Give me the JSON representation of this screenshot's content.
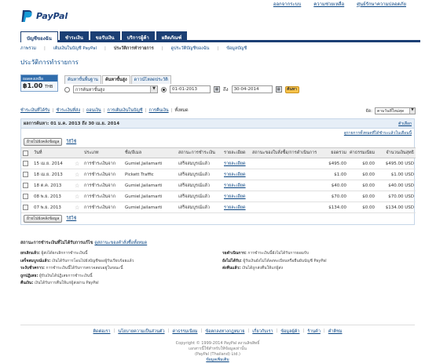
{
  "header": {
    "logo_text": "PayPal",
    "top_links": [
      "ออกจากระบบ",
      "ความช่วยเหลือ",
      "ศูนย์รักษาความปลอดภัย"
    ]
  },
  "tabs": [
    "บัญชีของฉัน",
    "ชำระเงิน",
    "ขอรับเงิน",
    "บริการผู้ค้า",
    "ผลิตภัณฑ์"
  ],
  "subnav": [
    "ภาพรวม",
    "เติมเงินในบัญชี PayPal",
    "ประวัติการทำรายการ",
    "ดูประวัติบัญชีของฉัน",
    "ข้อมูลบัญชี"
  ],
  "page_title": "ประวัติการทำรายการ",
  "balance": {
    "header": "ยอดคงเหลือ",
    "amount": "฿1.00",
    "currency": "THB"
  },
  "view_tabs": [
    "ค้นหาขั้นพื้นฐาน",
    "ค้นหาขั้นสูง",
    "ดาวน์โหลดประวัติ"
  ],
  "filter": {
    "select_value": "การค้นหาขั้นสูง",
    "date_from": "01-01-2013",
    "date_to": "30-04-2014",
    "go_label": "ค้นหา",
    "to_label": "ถึง"
  },
  "quick_filters": [
    "ชำระเงินที่ได้รับ",
    "ชำระเงินที่ส่ง",
    "ถอนเงิน",
    "การเติมเงินในบัญชี",
    "การคืนเงิน",
    "ทั้งหมด"
  ],
  "sort": {
    "label": "จัด:",
    "value": "ตามวันที่ใหม่สุด"
  },
  "panel": {
    "range_text": "ผลการค้นหา: 01 ม.ค. 2013 ถึง 30 เม.ย. 2014",
    "right_link": "ตัวเลือก",
    "notice": "ดูรายการทั้งหมดที่ได้ชำระแล้วในเดือนนี้",
    "archive_btn": "ย้ายไปยังคลังข้อมูล",
    "help_link": "วิธีใช้",
    "columns": [
      "",
      "วันที่",
      "",
      "ประเภท",
      "ชื่อ/อีเมล",
      "สถานะการชำระเงิน",
      "รายละเอียด",
      "สถานะของใบสั่งซื้อ/การดำเนินการ",
      "ยอดรวม",
      "ค่าธรรมเนียม",
      "จำนวนเงินสุทธิ"
    ],
    "rows": [
      {
        "date": "15 เม.ย. 2014",
        "type": "การชำระเงินจาก",
        "name": "Gumiel.Jailamarti",
        "status": "เสร็จสมบูรณ์แล้ว",
        "details": "รายละเอียด",
        "gross": "$495.00",
        "fee": "$0.00",
        "net": "$495.00 USD"
      },
      {
        "date": "18 เม.ย. 2013",
        "type": "การชำระเงินจาก",
        "name": "Pickett Traffic",
        "status": "เสร็จสมบูรณ์แล้ว",
        "details": "รายละเอียด",
        "gross": "$1.00",
        "fee": "$0.00",
        "net": "$1.00 USD"
      },
      {
        "date": "18 ต.ค. 2013",
        "type": "การชำระเงินจาก",
        "name": "Gumiel.Jailamarti",
        "status": "เสร็จสมบูรณ์แล้ว",
        "details": "รายละเอียด",
        "gross": "$40.00",
        "fee": "$0.00",
        "net": "$40.00 USD"
      },
      {
        "date": "08 พ.ย. 2013",
        "type": "การชำระเงินจาก",
        "name": "Gumiel.Jailamarti",
        "status": "เสร็จสมบูรณ์แล้ว",
        "details": "รายละเอียด",
        "gross": "$70.00",
        "fee": "$0.00",
        "net": "$70.00 USD"
      },
      {
        "date": "07 พ.ย. 2013",
        "type": "การชำระเงินจาก",
        "name": "Gumiel.Jailamarti",
        "status": "เสร็จสมบูรณ์แล้ว",
        "details": "รายละเอียด",
        "gross": "$134.00",
        "fee": "$0.00",
        "net": "$134.00 USD"
      }
    ]
  },
  "explain": {
    "heading": "สถานะการชำระเงินที่ไม่ได้รับการแก้ไข",
    "heading_link": "ดูสถานะของคำสั่งซื้อทั้งหมด",
    "left": [
      {
        "term": "ยกเลิกแล้ว:",
        "text": "ผู้ส่งได้ยกเลิกการชำระเงินนี้"
      },
      {
        "term": "เสร็จสมบูรณ์แล้ว:",
        "text": "เงินได้รับการโอนไปยังบัญชีของผู้รับเรียบร้อยแล้ว"
      },
      {
        "term": "ระงับชั่วคราว:",
        "text": "การชำระเงินนี้ได้รับการตรวจสอบอยู่ในขณะนี้"
      },
      {
        "term": "ถูกปฏิเสธ:",
        "text": "ผู้รับเงินได้ปฏิเสธการชำระเงินนี้"
      },
      {
        "term": "คืนเงิน:",
        "text": "เงินได้รับการคืนให้แก่ผู้ส่งผ่าน PayPal"
      }
    ],
    "right": [
      {
        "term": "รอดำเนินการ:",
        "text": "การชำระเงินนี้ยังไม่ได้รับการยอมรับ"
      },
      {
        "term": "ยังไม่ได้รับ:",
        "text": "ผู้รับเงินยังไม่ได้ลงทะเบียนหรือยืนยันบัญชี PayPal"
      },
      {
        "term": "ส่งคืนแล้ว:",
        "text": "เงินได้ถูกส่งคืนให้แก่ผู้ส่ง"
      }
    ]
  },
  "footer": {
    "links": [
      "ติดต่อเรา",
      "นโยบายความเป็นส่วนตัว",
      "ค่าธรรมเนียม",
      "ข้อตกลงทางกฎหมาย",
      "เกี่ยวกับเรา",
      "ข้อมูลผู้ค้า",
      "ร้านค้า",
      "คำติชม"
    ],
    "copyright_lines": [
      "Copyright © 1999-2014 PayPal สงวนลิขสิทธิ์",
      "เอกสารนี้ใช้สำหรับให้ข้อมูลเท่านั้น",
      "(PayPal (Thailand) Ltd.)",
      "ข้อมูลเพิ่มเติม"
    ]
  }
}
